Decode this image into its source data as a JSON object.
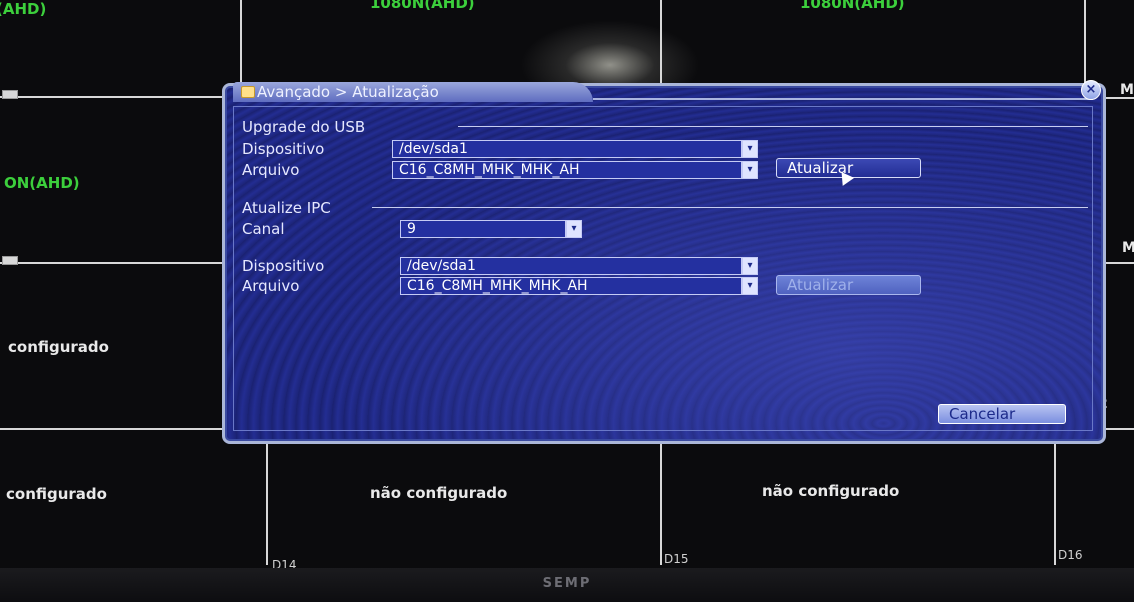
{
  "background": {
    "top_labels": [
      "(AHD)",
      "1080N(AHD)",
      "1080N(AHD)"
    ],
    "left_label_1": "ON(AHD)",
    "left_label_2": "configurado",
    "left_label_3": "configurado",
    "cell_15_text": "não configurado",
    "cell_16_text": "não configurado",
    "channel_ids": [
      "D14",
      "D15",
      "D16"
    ],
    "right_edge": [
      "M",
      "M",
      "2"
    ],
    "brand": "SEMP"
  },
  "dialog": {
    "title": "Avançado > Atualização",
    "close_symbol": "×",
    "usb_section": {
      "heading": "Upgrade do USB",
      "device_label": "Dispositivo",
      "device_value": "/dev/sda1",
      "file_label": "Arquivo",
      "file_value": "C16_C8MH_MHK_MHK_AH",
      "update_button": "Atualizar"
    },
    "ipc_section": {
      "heading": "Atualize IPC",
      "channel_label": "Canal",
      "channel_value": "9",
      "device_label": "Dispositivo",
      "device_value": "/dev/sda1",
      "file_label": "Arquivo",
      "file_value": "C16_C8MH_MHK_MHK_AH",
      "update_button": "Atualizar"
    },
    "cancel_button": "Cancelar",
    "dropdown_glyph": "▾"
  }
}
